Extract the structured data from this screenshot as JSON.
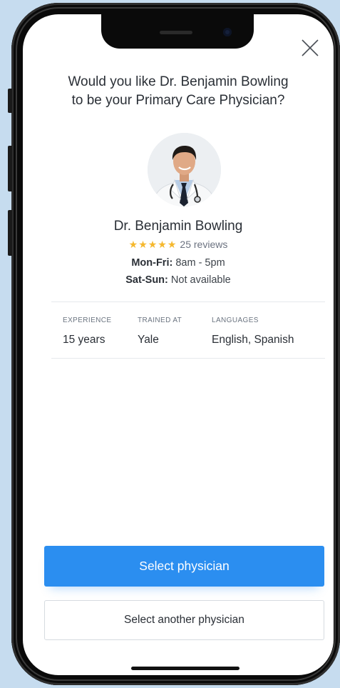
{
  "modal": {
    "question_line1": "Would you like Dr. Benjamin Bowling",
    "question_line2": "to be your Primary Care Physician?",
    "close_icon": "close-icon"
  },
  "doctor": {
    "name": "Dr. Benjamin Bowling",
    "rating_stars": "★★★★★",
    "star_color": "#f5b82e",
    "reviews": "25 reviews",
    "weekday_label": "Mon-Fri:",
    "weekday_hours": "8am - 5pm",
    "weekend_label": "Sat-Sun:",
    "weekend_hours": "Not available"
  },
  "stats": [
    {
      "label": "EXPERIENCE",
      "value": "15 years"
    },
    {
      "label": "TRAINED AT",
      "value": "Yale"
    },
    {
      "label": "LANGUAGES",
      "value": "English, Spanish"
    }
  ],
  "actions": {
    "primary_label": "Select physician",
    "secondary_label": "Select another physician",
    "primary_color": "#2b8ef0"
  }
}
